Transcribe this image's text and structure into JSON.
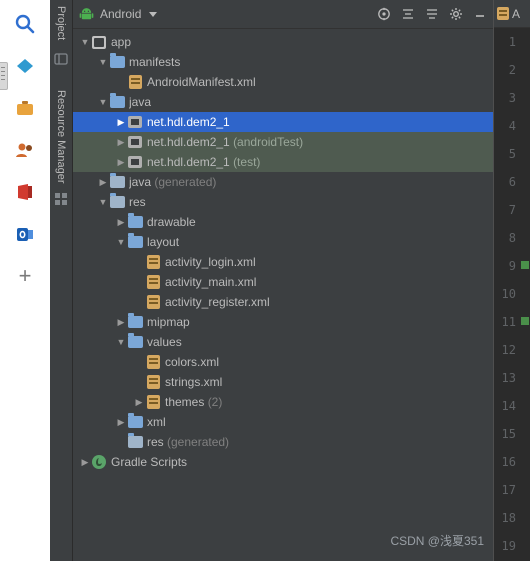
{
  "left_rail": {
    "icons": [
      {
        "name": "search-icon",
        "color": "#2f6fd0"
      },
      {
        "name": "bookmark-icon",
        "color": "#2f9ad0"
      },
      {
        "name": "briefcase-icon",
        "color": "#e8a33d"
      },
      {
        "name": "people-icon",
        "color": "#d06a2f"
      },
      {
        "name": "office-icon",
        "color": "#d13a2f"
      },
      {
        "name": "outlook-icon",
        "color": "#1a5fb4"
      }
    ],
    "add_label": "+"
  },
  "stripe": {
    "project_label": "Project",
    "resource_label": "Resource Manager"
  },
  "panel": {
    "title": "Android",
    "toolbar": [
      {
        "name": "target-icon",
        "label": "⊕"
      },
      {
        "name": "collapse-all-icon",
        "label": "≡"
      },
      {
        "name": "expand-all-icon",
        "label": "↕"
      },
      {
        "name": "settings-gear-icon",
        "label": "⚙"
      },
      {
        "name": "minimize-icon",
        "label": "−"
      }
    ]
  },
  "tree": [
    {
      "indent": 0,
      "arrow": "down",
      "icon": "module-icon",
      "label": "app",
      "suffix": "",
      "state": "normal"
    },
    {
      "indent": 1,
      "arrow": "down",
      "icon": "folder-icon",
      "label": "manifests",
      "suffix": "",
      "state": "normal"
    },
    {
      "indent": 2,
      "arrow": "none",
      "icon": "xml-icon",
      "label": "AndroidManifest.xml",
      "suffix": "",
      "state": "normal"
    },
    {
      "indent": 1,
      "arrow": "down",
      "icon": "folder-icon",
      "label": "java",
      "suffix": "",
      "state": "normal"
    },
    {
      "indent": 2,
      "arrow": "right",
      "icon": "package-icon",
      "label": "net.hdl.dem2_1",
      "suffix": "",
      "state": "selected"
    },
    {
      "indent": 2,
      "arrow": "right",
      "icon": "package-icon",
      "label": "net.hdl.dem2_1",
      "suffix": "(androidTest)",
      "state": "ghost"
    },
    {
      "indent": 2,
      "arrow": "right",
      "icon": "package-icon",
      "label": "net.hdl.dem2_1",
      "suffix": "(test)",
      "state": "ghost"
    },
    {
      "indent": 1,
      "arrow": "right",
      "icon": "folder-gen-icon",
      "label": "java",
      "suffix": "(generated)",
      "state": "normal"
    },
    {
      "indent": 1,
      "arrow": "down",
      "icon": "res-icon",
      "label": "res",
      "suffix": "",
      "state": "normal"
    },
    {
      "indent": 2,
      "arrow": "right",
      "icon": "folder-icon",
      "label": "drawable",
      "suffix": "",
      "state": "normal"
    },
    {
      "indent": 2,
      "arrow": "down",
      "icon": "folder-icon",
      "label": "layout",
      "suffix": "",
      "state": "normal"
    },
    {
      "indent": 3,
      "arrow": "none",
      "icon": "xml-icon",
      "label": "activity_login.xml",
      "suffix": "",
      "state": "normal"
    },
    {
      "indent": 3,
      "arrow": "none",
      "icon": "xml-icon",
      "label": "activity_main.xml",
      "suffix": "",
      "state": "normal"
    },
    {
      "indent": 3,
      "arrow": "none",
      "icon": "xml-icon",
      "label": "activity_register.xml",
      "suffix": "",
      "state": "normal"
    },
    {
      "indent": 2,
      "arrow": "right",
      "icon": "folder-icon",
      "label": "mipmap",
      "suffix": "",
      "state": "normal"
    },
    {
      "indent": 2,
      "arrow": "down",
      "icon": "folder-icon",
      "label": "values",
      "suffix": "",
      "state": "normal"
    },
    {
      "indent": 3,
      "arrow": "none",
      "icon": "xml-icon",
      "label": "colors.xml",
      "suffix": "",
      "state": "normal"
    },
    {
      "indent": 3,
      "arrow": "none",
      "icon": "xml-icon",
      "label": "strings.xml",
      "suffix": "",
      "state": "normal"
    },
    {
      "indent": 3,
      "arrow": "right",
      "icon": "xml-icon",
      "label": "themes",
      "suffix": "(2)",
      "state": "normal"
    },
    {
      "indent": 2,
      "arrow": "right",
      "icon": "folder-icon",
      "label": "xml",
      "suffix": "",
      "state": "normal"
    },
    {
      "indent": 2,
      "arrow": "none",
      "icon": "res-gen-icon",
      "label": "res",
      "suffix": "(generated)",
      "state": "normal"
    },
    {
      "indent": 0,
      "arrow": "right",
      "icon": "gradle-icon",
      "label": "Gradle Scripts",
      "suffix": "",
      "state": "normal"
    }
  ],
  "watermark": "CSDN @浅夏351",
  "editor": {
    "tab_label": "A",
    "tab_icon": "xml-file-icon",
    "line_numbers": [
      "1",
      "2",
      "3",
      "4",
      "5",
      "6",
      "7",
      "8",
      "9",
      "10",
      "11",
      "12",
      "13",
      "14",
      "15",
      "16",
      "17",
      "18",
      "19"
    ],
    "fold_marker_lines": [
      "9",
      "11"
    ]
  }
}
